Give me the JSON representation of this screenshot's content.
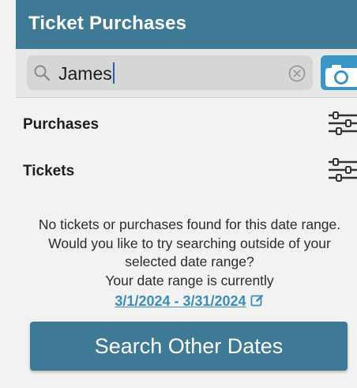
{
  "header": {
    "title": "Ticket Purchases"
  },
  "search": {
    "value": "James"
  },
  "sections": [
    {
      "label": "Purchases"
    },
    {
      "label": "Tickets"
    }
  ],
  "empty_state": {
    "message": "No tickets or purchases found for this date range. Would you like to try searching outside of your selected date range?",
    "range_prefix": "Your date range is currently",
    "date_range": "3/1/2024 - 3/31/2024",
    "button_label": "Search Other Dates"
  },
  "icons": {
    "search": "search-icon",
    "clear": "clear-icon",
    "camera": "camera-icon",
    "filter": "filter-icon",
    "edit": "edit-icon"
  },
  "colors": {
    "brand": "#3e7a96",
    "accent": "#3b95c6",
    "link": "#3b8fb6",
    "background": "#f2f2f2"
  }
}
